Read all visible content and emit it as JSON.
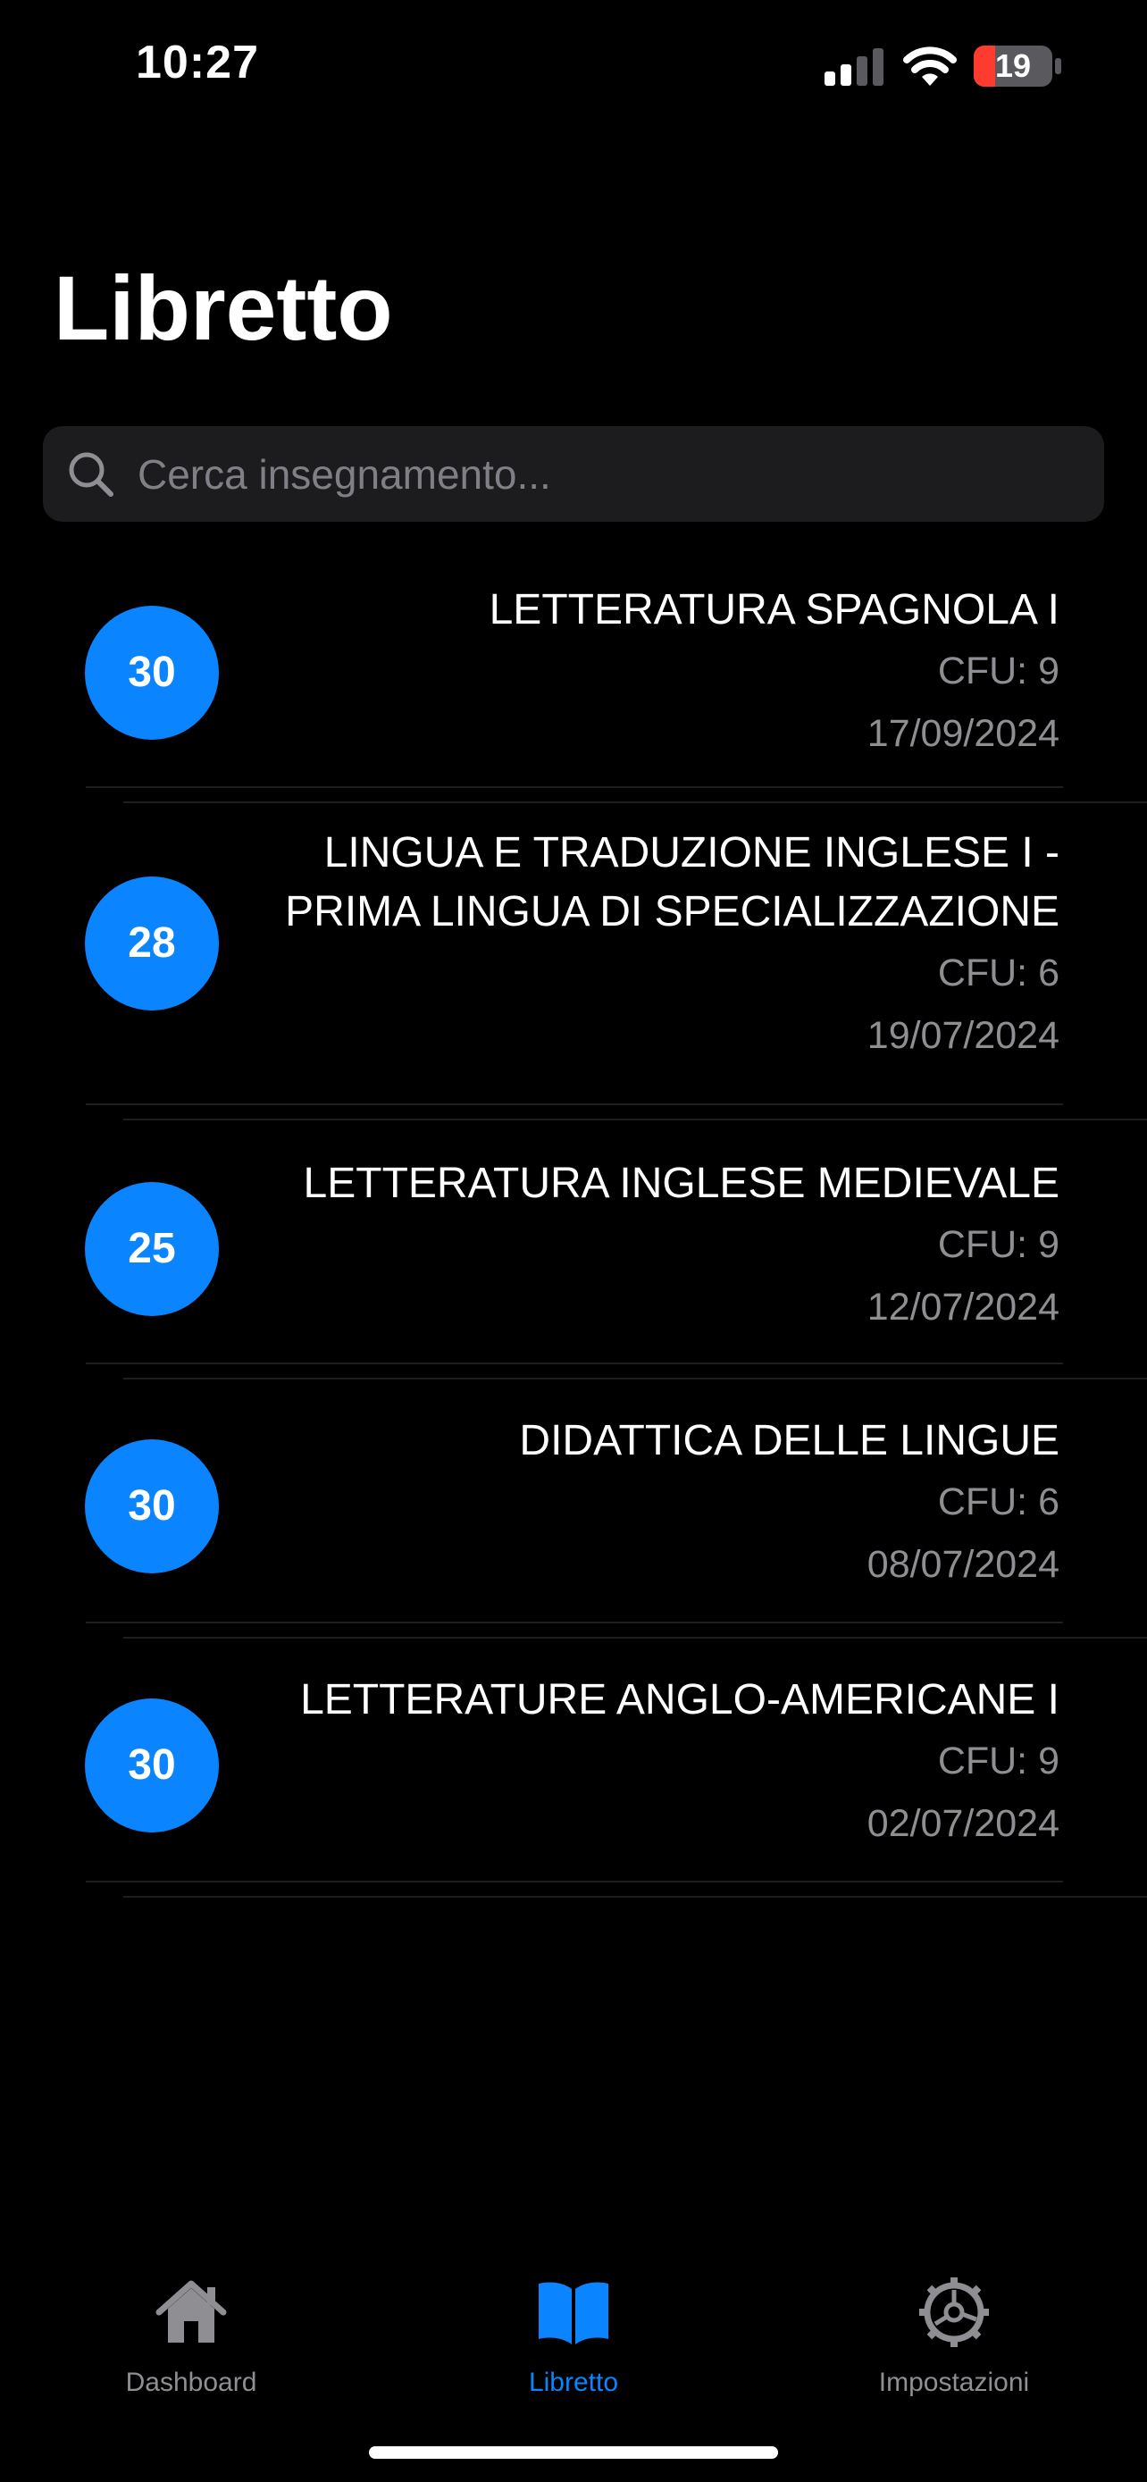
{
  "status_bar": {
    "time": "10:27",
    "battery_level": "19",
    "signal_icon": "cellular-signal-icon",
    "wifi_icon": "wifi-icon",
    "battery_icon": "battery-icon"
  },
  "page": {
    "title": "Libretto"
  },
  "search": {
    "placeholder": "Cerca insegnamento...",
    "value": "",
    "icon": "search-icon"
  },
  "exams": [
    {
      "grade": "30",
      "name_lines": [
        "LETTERATURA SPAGNOLA I"
      ],
      "cfu": "CFU: 9",
      "date": "17/09/2024"
    },
    {
      "grade": "28",
      "name_lines": [
        "LINGUA E TRADUZIONE INGLESE I -",
        "PRIMA LINGUA DI SPECIALIZZAZIONE"
      ],
      "cfu": "CFU: 6",
      "date": "19/07/2024"
    },
    {
      "grade": "25",
      "name_lines": [
        "LETTERATURA INGLESE MEDIEVALE"
      ],
      "cfu": "CFU: 9",
      "date": "12/07/2024"
    },
    {
      "grade": "30",
      "name_lines": [
        "DIDATTICA DELLE LINGUE"
      ],
      "cfu": "CFU: 6",
      "date": "08/07/2024"
    },
    {
      "grade": "30",
      "name_lines": [
        "LETTERATURE ANGLO-AMERICANE I"
      ],
      "cfu": "CFU: 9",
      "date": "02/07/2024"
    }
  ],
  "tab_bar": {
    "tabs": [
      {
        "label": "Dashboard",
        "icon": "house-icon",
        "active": false
      },
      {
        "label": "Libretto",
        "icon": "book-icon",
        "active": true
      },
      {
        "label": "Impostazioni",
        "icon": "gear-icon",
        "active": false
      }
    ]
  },
  "colors": {
    "accent": "#0a84ff",
    "background": "#000000",
    "secondary_text": "#8e8e93",
    "inactive_tab": "#8e8e93",
    "battery_low": "#ff3b30"
  }
}
